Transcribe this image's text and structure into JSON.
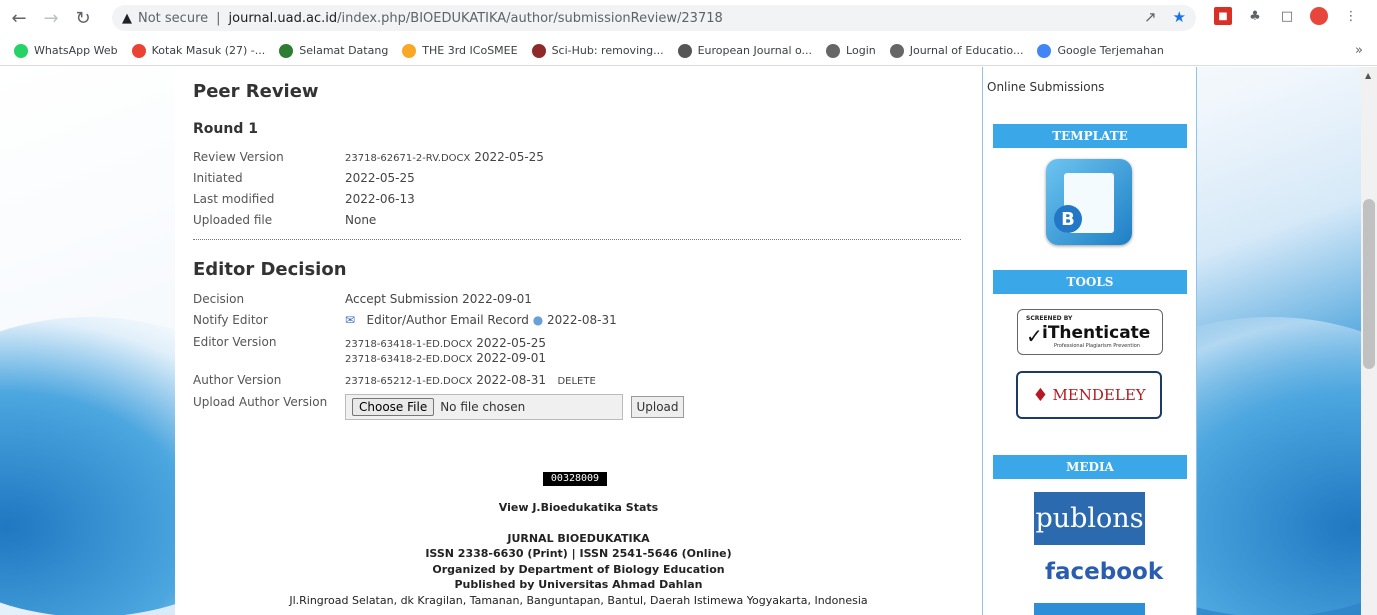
{
  "browser": {
    "security_label": "Not secure",
    "url_host": "journal.uad.ac.id",
    "url_path": "/index.php/BIOEDUKATIKA/author/submissionReview/23718"
  },
  "bookmarks": [
    {
      "label": "WhatsApp Web",
      "color": "#25d366"
    },
    {
      "label": "Kotak Masuk (27) -...",
      "color": "#ea4335"
    },
    {
      "label": "Selamat Datang",
      "color": "#2e7d32"
    },
    {
      "label": "THE 3rd ICoSMEE",
      "color": "#f9a825"
    },
    {
      "label": "Sci-Hub: removing...",
      "color": "#8e2a2a"
    },
    {
      "label": "European Journal o...",
      "color": "#555555"
    },
    {
      "label": "Login",
      "color": "#666666"
    },
    {
      "label": "Journal of Educatio...",
      "color": "#666666"
    },
    {
      "label": "Google Terjemahan",
      "color": "#4285f4"
    }
  ],
  "peer_review": {
    "title": "Peer Review",
    "round": "Round 1",
    "rows": [
      {
        "label": "Review Version",
        "file": "23718-62671-2-RV.DOCX",
        "date": "2022-05-25"
      },
      {
        "label": "Initiated",
        "value": "2022-05-25"
      },
      {
        "label": "Last modified",
        "value": "2022-06-13"
      },
      {
        "label": "Uploaded file",
        "value": "None"
      }
    ]
  },
  "editor_decision": {
    "title": "Editor Decision",
    "decision_label": "Decision",
    "decision_value": "Accept Submission 2022-09-01",
    "notify_label": "Notify Editor",
    "notify_link": "Editor/Author Email Record",
    "notify_date": "2022-08-31",
    "editor_version_label": "Editor Version",
    "editor_versions": [
      {
        "file": "23718-63418-1-ED.DOCX",
        "date": "2022-05-25"
      },
      {
        "file": "23718-63418-2-ED.DOCX",
        "date": "2022-09-01"
      }
    ],
    "author_version_label": "Author Version",
    "author_version": {
      "file": "23718-65212-1-ED.DOCX",
      "date": "2022-08-31",
      "delete": "DELETE"
    },
    "upload_label": "Upload Author Version",
    "choose_file": "Choose File",
    "no_file": "No file chosen",
    "upload_button": "Upload"
  },
  "footer": {
    "counter": "00328009",
    "stats_link": "View J.Bioedukatika Stats",
    "journal": "JURNAL BIOEDUKATIKA",
    "issn": "ISSN 2338-6630 (Print) | ISSN 2541-5646 (Online)",
    "organized": "Organized by Department of Biology Education",
    "published": "Published by Universitas Ahmad Dahlan",
    "address": "Jl.Ringroad Selatan, dk Kragilan, Tamanan, Banguntapan, Bantul, Daerah Istimewa Yogyakarta, Indonesia"
  },
  "sidebar": {
    "online_submissions": "Online Submissions",
    "template": "TEMPLATE",
    "tools": "TOOLS",
    "media": "MEDIA",
    "ithenticate_screened": "SCREENED BY",
    "ithenticate_name": "iThenticate",
    "ithenticate_tag": "Professional Plagiarism Prevention",
    "mendeley": "MENDELEY",
    "publons": "publons",
    "facebook": "facebook"
  }
}
